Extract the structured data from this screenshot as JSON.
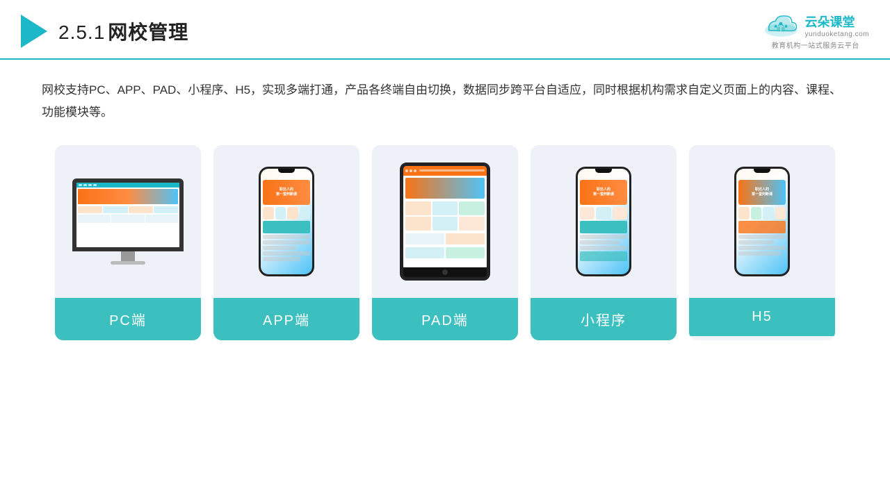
{
  "header": {
    "section_number": "2.5.1",
    "title": "网校管理",
    "logo_name": "云朵课堂",
    "logo_url": "yunduoketang.com",
    "logo_tagline": "教育机构一站式服务云平台"
  },
  "description": {
    "text": "网校支持PC、APP、PAD、小程序、H5，实现多端打通，产品各终端自由切换，数据同步跨平台自适应，同时根据机构需求自定义页面上的内容、课程、功能模块等。"
  },
  "cards": [
    {
      "id": "pc",
      "label": "PC端",
      "device": "pc"
    },
    {
      "id": "app",
      "label": "APP端",
      "device": "phone"
    },
    {
      "id": "pad",
      "label": "PAD端",
      "device": "tablet"
    },
    {
      "id": "miniprogram",
      "label": "小程序",
      "device": "phone2"
    },
    {
      "id": "h5",
      "label": "H5",
      "device": "phone3"
    }
  ],
  "colors": {
    "teal": "#3cbfbf",
    "accent": "#1db8c8",
    "orange": "#f97316",
    "dark": "#222"
  }
}
